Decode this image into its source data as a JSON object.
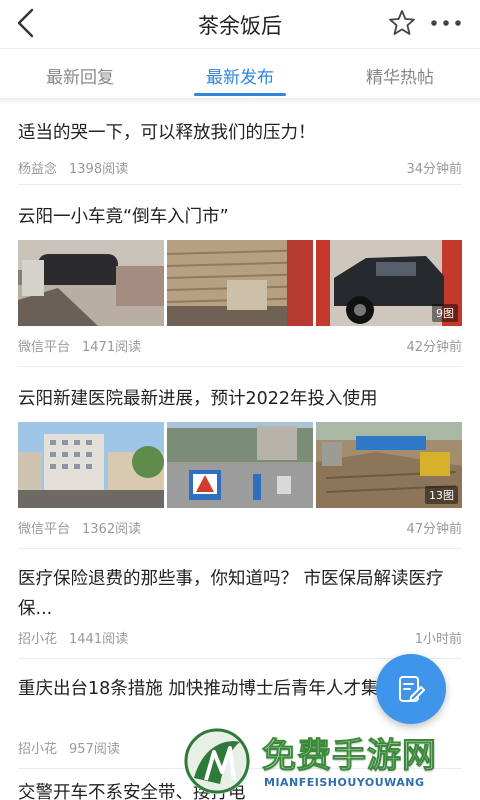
{
  "header": {
    "title": "茶余饭后",
    "back_icon": "chevron-left-icon",
    "star_icon": "star-outline-icon",
    "more_icon": "more-dots-icon"
  },
  "tabs": [
    {
      "label": "最新回复",
      "active": false
    },
    {
      "label": "最新发布",
      "active": true
    },
    {
      "label": "精华热帖",
      "active": false
    }
  ],
  "posts": [
    {
      "title": "适当的哭一下，可以释放我们的压力！",
      "author": "杨益念",
      "views": "1398阅读",
      "time": "34分钟前"
    },
    {
      "title": "云阳一小车竟“倒车入门市”",
      "author": "微信平台",
      "views": "1471阅读",
      "time": "42分钟前",
      "image_count": "9图"
    },
    {
      "title": "云阳新建医院最新进展，预计2022年投入使用",
      "author": "微信平台",
      "views": "1362阅读",
      "time": "47分钟前",
      "image_count": "13图"
    },
    {
      "title": "医疗保险退费的那些事，你知道吗？ 市医保局解读医疗保...",
      "author": "招小花",
      "views": "1441阅读",
      "time": "1小时前"
    },
    {
      "title": "重庆出台18条措施 加快推动博士后青年人才集聚",
      "author": "招小花",
      "views": "957阅读",
      "time": ""
    },
    {
      "title": "交警开车不系安全带、接打电",
      "author": "",
      "views": "",
      "time": ""
    }
  ],
  "fab": {
    "icon": "edit-post-icon"
  },
  "watermark": {
    "text": "免费手游网",
    "sub": "MIANFEISHOUYOUWANG"
  },
  "colors": {
    "accent": "#2f87d9",
    "fab": "#3f95ea",
    "meta": "#999999"
  }
}
